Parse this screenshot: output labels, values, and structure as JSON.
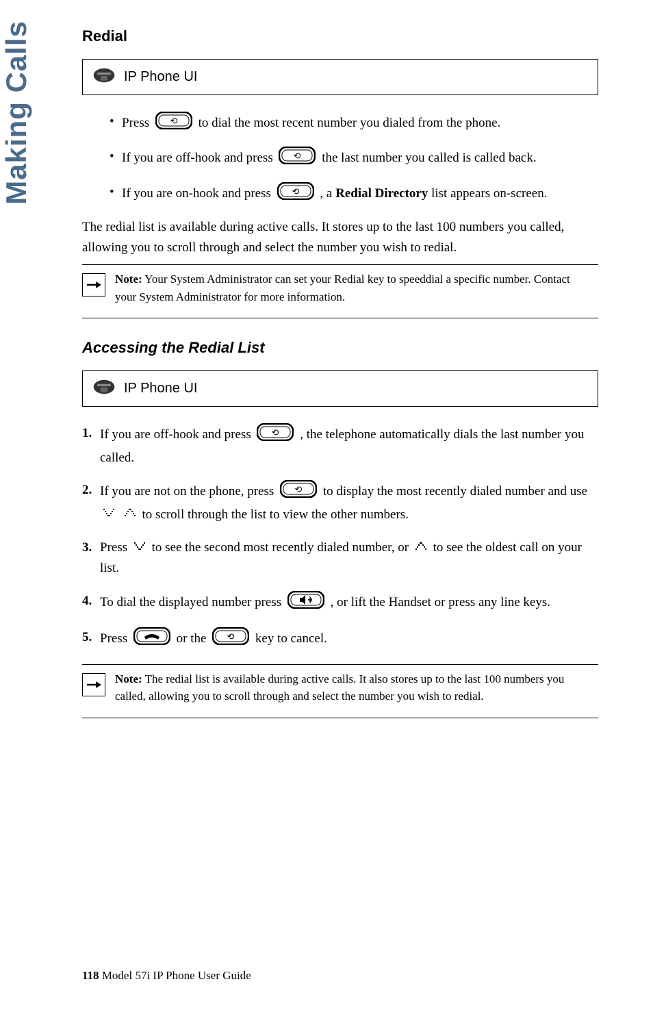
{
  "sideTab": "Making Calls",
  "title": "Redial",
  "uiBox1": "IP Phone UI",
  "bullets": {
    "b1_a": "Press",
    "b1_b": "to dial the most recent number you dialed from the phone.",
    "b2_a": "If you are off-hook and press",
    "b2_b": "the last number you called is called back.",
    "b3_a": "If you are on-hook and press",
    "b3_b": ", a ",
    "b3_bold": "Redial Directory",
    "b3_c": " list appears on-screen."
  },
  "para1": "The redial list is available during active calls. It stores up to the last 100 numbers you called, allowing you to scroll through and select the number you wish to redial.",
  "note1": {
    "label": "Note:",
    "text": " Your System Administrator can set your Redial key to speeddial a specific number. Contact your System Administrator for more information."
  },
  "subheading": "Accessing the Redial List",
  "uiBox2": "IP Phone UI",
  "steps": {
    "s1_num": "1.",
    "s1_a": "If you are off-hook and press ",
    "s1_b": ", the telephone automatically dials the last number you called.",
    "s2_num": "2.",
    "s2_a": "If you are not on the phone, press ",
    "s2_b": " to display the most recently dialed number and use ",
    "s2_c": " to scroll through the list to view the other numbers.",
    "s3_num": "3.",
    "s3_a": "Press ",
    "s3_b": " to see the second most recently dialed number, or ",
    "s3_c": " to see the oldest call on your list.",
    "s4_num": "4.",
    "s4_a": "To dial the displayed number press ",
    "s4_b": " , or lift the Handset or press any line keys.",
    "s5_num": "5.",
    "s5_a": "Press ",
    "s5_b": " or the ",
    "s5_c": " key to cancel."
  },
  "note2": {
    "label": "Note:",
    "text": " The redial list is available during active calls. It also stores up to the last 100 numbers you called, allowing you to scroll through and select the number you wish to redial."
  },
  "footer": {
    "pageNum": "118",
    "text": "  Model 57i IP Phone User Guide"
  }
}
